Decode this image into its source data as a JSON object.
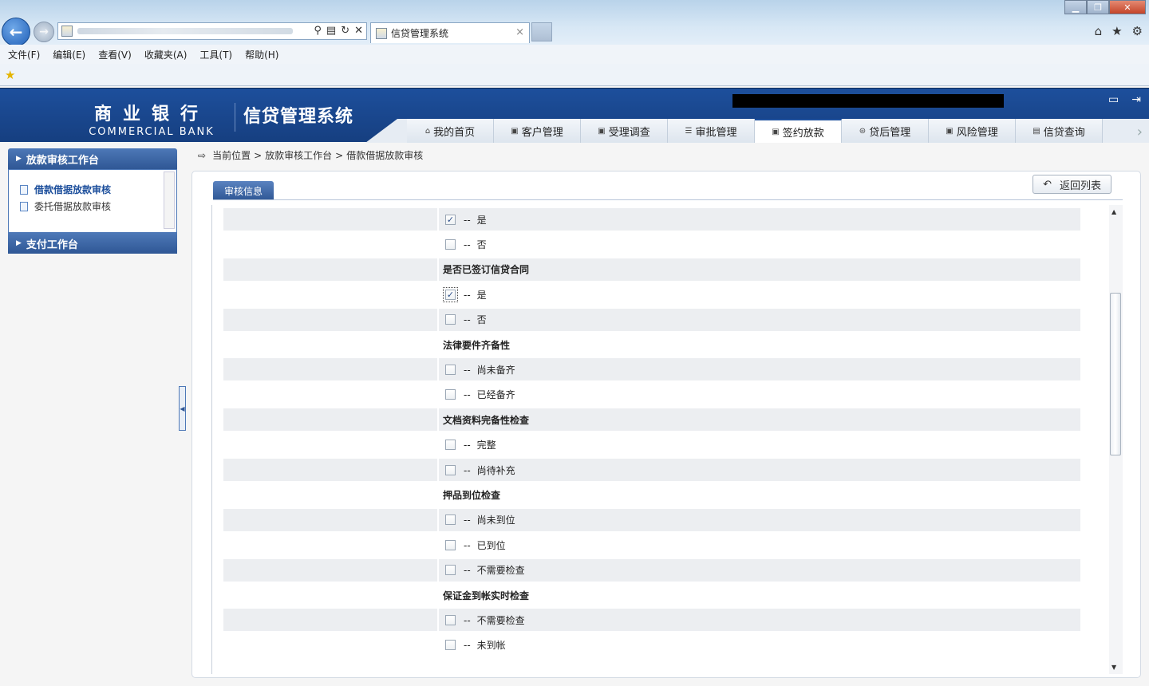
{
  "browser": {
    "tab_title": "信贷管理系统",
    "menu": [
      "文件(F)",
      "编辑(E)",
      "查看(V)",
      "收藏夹(A)",
      "工具(T)",
      "帮助(H)"
    ]
  },
  "header": {
    "logo_cn": "商业银行",
    "logo_en": "COMMERCIAL BANK",
    "system_name": "信贷管理系统",
    "nav": [
      {
        "label": "我的首页",
        "icon": "home-icon",
        "active": false
      },
      {
        "label": "客户管理",
        "icon": "customer-icon",
        "active": false
      },
      {
        "label": "受理调查",
        "icon": "survey-icon",
        "active": false
      },
      {
        "label": "审批管理",
        "icon": "approval-icon",
        "active": false
      },
      {
        "label": "签约放款",
        "icon": "contract-icon",
        "active": true
      },
      {
        "label": "贷后管理",
        "icon": "post-loan-icon",
        "active": false
      },
      {
        "label": "风险管理",
        "icon": "risk-icon",
        "active": false
      },
      {
        "label": "信贷查询",
        "icon": "query-icon",
        "active": false
      }
    ]
  },
  "sidebar": {
    "section1_title": "放款审核工作台",
    "items": [
      "借款借据放款审核",
      "委托借据放款审核"
    ],
    "section2_title": "支付工作台"
  },
  "breadcrumb": {
    "label": "当前位置",
    "sep": ">",
    "path1": "放款审核工作台",
    "path2": "借款借据放款审核"
  },
  "panel": {
    "tab_label": "审核信息",
    "back_button": "返回列表"
  },
  "form": {
    "rows": [
      {
        "type": "option",
        "prefix": "--",
        "label": "是",
        "checked": true,
        "shade": true
      },
      {
        "type": "option",
        "prefix": "--",
        "label": "否",
        "checked": false,
        "shade": false
      },
      {
        "type": "title",
        "label": "是否已签订信贷合同",
        "shade": true
      },
      {
        "type": "option",
        "prefix": "--",
        "label": "是",
        "checked": true,
        "shade": false,
        "focus": true
      },
      {
        "type": "option",
        "prefix": "--",
        "label": "否",
        "checked": false,
        "shade": true
      },
      {
        "type": "title",
        "label": "法律要件齐备性",
        "shade": false
      },
      {
        "type": "option",
        "prefix": "--",
        "label": "尚未备齐",
        "checked": false,
        "shade": true
      },
      {
        "type": "option",
        "prefix": "--",
        "label": "已经备齐",
        "checked": false,
        "shade": false
      },
      {
        "type": "title",
        "label": "文档资料完备性检查",
        "shade": true
      },
      {
        "type": "option",
        "prefix": "--",
        "label": "完整",
        "checked": false,
        "shade": false
      },
      {
        "type": "option",
        "prefix": "--",
        "label": "尚待补充",
        "checked": false,
        "shade": true
      },
      {
        "type": "title",
        "label": "押品到位检查",
        "shade": false
      },
      {
        "type": "option",
        "prefix": "--",
        "label": "尚未到位",
        "checked": false,
        "shade": true
      },
      {
        "type": "option",
        "prefix": "--",
        "label": "已到位",
        "checked": false,
        "shade": false
      },
      {
        "type": "option",
        "prefix": "--",
        "label": "不需要检查",
        "checked": false,
        "shade": true
      },
      {
        "type": "title",
        "label": "保证金到帐实时检查",
        "shade": false
      },
      {
        "type": "option",
        "prefix": "--",
        "label": "不需要检查",
        "checked": false,
        "shade": true
      },
      {
        "type": "option",
        "prefix": "--",
        "label": "未到帐",
        "checked": false,
        "shade": false
      }
    ]
  }
}
